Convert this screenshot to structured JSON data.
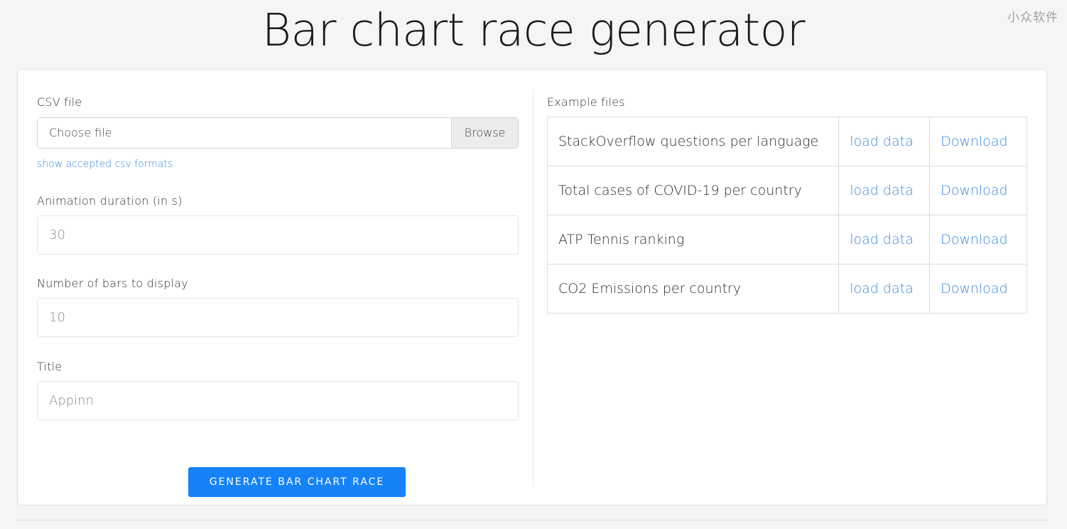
{
  "watermark": "小众软件",
  "page_title": "Bar chart race generator",
  "form": {
    "csv_label": "CSV file",
    "file_placeholder": "Choose file",
    "browse_label": "Browse",
    "csv_formats_link": "show accepted csv formats",
    "duration_label": "Animation duration (in s)",
    "duration_value": "30",
    "bars_label": "Number of bars to display",
    "bars_value": "10",
    "title_label": "Title",
    "title_value": "Appinn",
    "generate_button": "GENERATE BAR CHART RACE"
  },
  "examples": {
    "heading": "Example files",
    "rows": [
      {
        "name": "StackOverflow questions per language",
        "load": "load data",
        "download": "Download"
      },
      {
        "name": "Total cases of COVID-19 per country",
        "load": "load data",
        "download": "Download"
      },
      {
        "name": "ATP Tennis ranking",
        "load": "load data",
        "download": "Download"
      },
      {
        "name": "CO2 Emissions per country",
        "load": "load data",
        "download": "Download"
      }
    ]
  },
  "colors": {
    "link": "#3b87d9",
    "button": "#1582f7",
    "background": "#f5f5f5"
  }
}
